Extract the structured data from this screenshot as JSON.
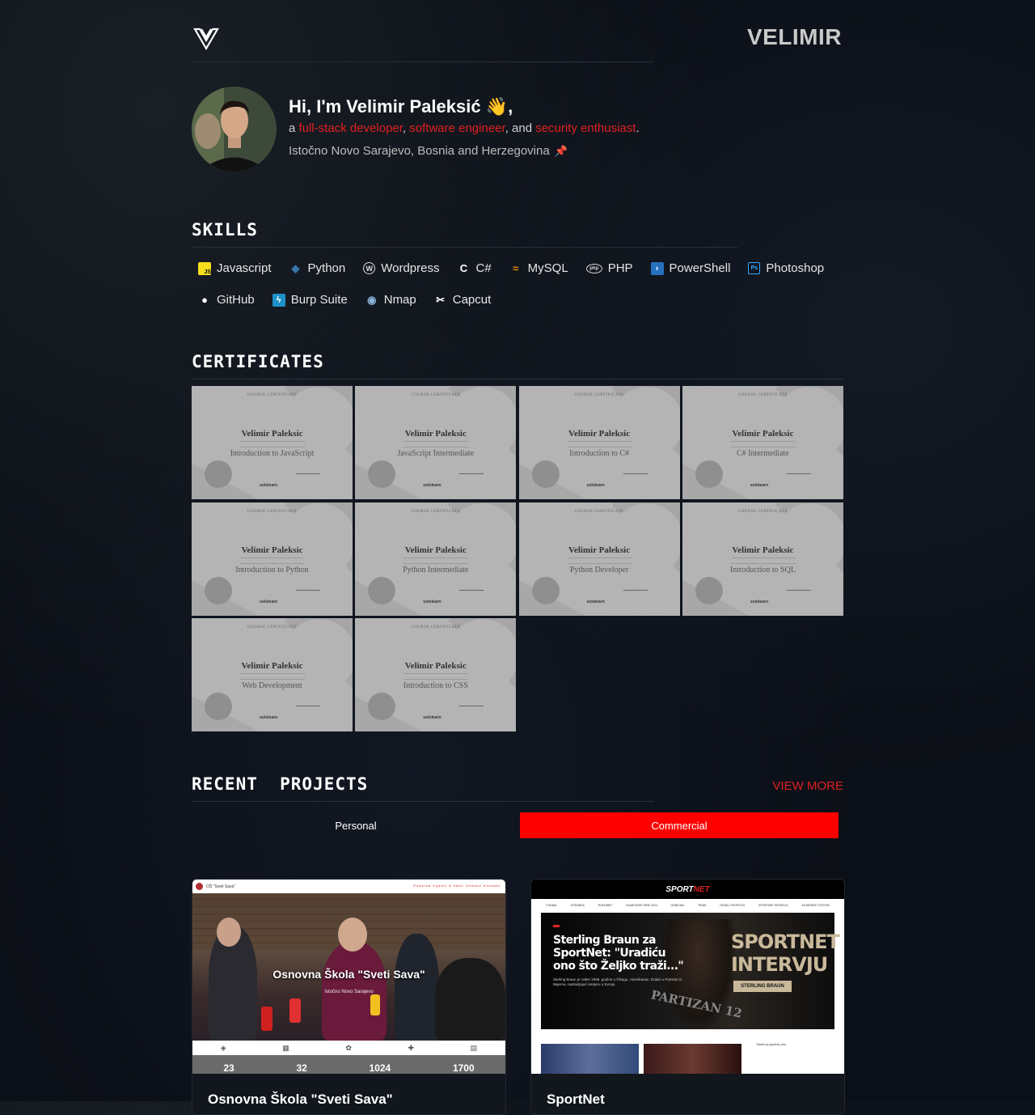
{
  "header": {
    "brand": "VELIMIR"
  },
  "intro": {
    "greeting": "Hi, I'm Velimir Paleksić 👋,",
    "tagline_prefix": "a ",
    "role1": "full-stack developer",
    "sep1": ", ",
    "role2": "software engineer",
    "sep2": ", and ",
    "role3": "security enthusiast",
    "tagline_suffix": ".",
    "location": "Istočno Novo Sarajevo, Bosnia and Herzegovina"
  },
  "skills": {
    "title": "SKILLS",
    "items": [
      {
        "label": "Javascript",
        "icon": "javascript-icon",
        "color": "#f7df1e"
      },
      {
        "label": "Python",
        "icon": "python-icon",
        "color": "#3776ab"
      },
      {
        "label": "Wordpress",
        "icon": "wordpress-icon",
        "color": "#21759b"
      },
      {
        "label": "C#",
        "icon": "csharp-icon",
        "color": "#ffffff"
      },
      {
        "label": "MySQL",
        "icon": "mysql-icon",
        "color": "#e48e00"
      },
      {
        "label": "PHP",
        "icon": "php-icon",
        "color": "#ffffff"
      },
      {
        "label": "PowerShell",
        "icon": "powershell-icon",
        "color": "#2671be"
      },
      {
        "label": "Photoshop",
        "icon": "photoshop-icon",
        "color": "#31a8ff"
      },
      {
        "label": "GitHub",
        "icon": "github-icon",
        "color": "#ffffff"
      },
      {
        "label": "Burp Suite",
        "icon": "burp-suite-icon",
        "color": "#1e90c8"
      },
      {
        "label": "Nmap",
        "icon": "nmap-icon",
        "color": "#8ab4d8"
      },
      {
        "label": "Capcut",
        "icon": "capcut-icon",
        "color": "#ffffff"
      }
    ]
  },
  "certificates": {
    "title": "CERTIFICATES",
    "items": [
      {
        "header": "COURSE CERTIFICATE",
        "name": "Velimir Paleksic",
        "course": "Introduction to JavaScript",
        "issuer": "sololearn"
      },
      {
        "header": "COURSE CERTIFICATE",
        "name": "Velimir Paleksic",
        "course": "JavaScript Intermediate",
        "issuer": "sololearn"
      },
      {
        "header": "COURSE CERTIFICATE",
        "name": "Velimir Paleksic",
        "course": "Introduction to C#",
        "issuer": "sololearn"
      },
      {
        "header": "COURSE CERTIFICATE",
        "name": "Velimir Paleksic",
        "course": "C# Intermediate",
        "issuer": "sololearn"
      },
      {
        "header": "COURSE CERTIFICATE",
        "name": "Velimir Paleksic",
        "course": "Introduction to Python",
        "issuer": "sololearn"
      },
      {
        "header": "COURSE CERTIFICATE",
        "name": "Velimir Paleksic",
        "course": "Python Intermediate",
        "issuer": "sololearn"
      },
      {
        "header": "COURSE CERTIFICATE",
        "name": "Velimir Paleksic",
        "course": "Python Developer",
        "issuer": "sololearn"
      },
      {
        "header": "COURSE CERTIFICATE",
        "name": "Velimir Paleksic",
        "course": "Introduction to SQL",
        "issuer": "sololearn"
      },
      {
        "header": "COURSE CERTIFICATE",
        "name": "Velimir Paleksic",
        "course": "Web Development",
        "issuer": "sololearn"
      },
      {
        "header": "COURSE CERTIFICATE",
        "name": "Velimir Paleksic",
        "course": "Introduction to CSS",
        "issuer": "sololearn"
      }
    ]
  },
  "projects": {
    "title": "RECENT  PROJECTS",
    "view_more": "VIEW MORE",
    "tabs": {
      "personal": "Personal",
      "commercial": "Commercial",
      "active": "Commercial"
    },
    "accent": "#ff0000",
    "cards": [
      {
        "name": "Osnovna Škola \"Sveti Sava\"",
        "shot": {
          "site_label": "OŠ \"Sveti Sava\"",
          "nav": "Početna  Vijesti  O školi  Učenici  Kontakt",
          "hero_title": "Osnovna Škola \"Sveti Sava\"",
          "hero_sub": "Istočno Novo Sarajevo",
          "icons": [
            "◈",
            "▦",
            "✿",
            "✚",
            "▤"
          ],
          "stats": [
            "23",
            "32",
            "1024",
            "1700"
          ]
        }
      },
      {
        "name": "SportNet",
        "shot": {
          "logo_a": "SPORT",
          "logo_b": "NET",
          "nav": [
            "FUDBAL",
            "KOŠARKA",
            "RUKOMET",
            "OLIMPIJSKE IGRE 2024",
            "ODBOJKA",
            "TENIS",
            "OSTALI SPORTOVI",
            "SPORTNET INTERVJU",
            "KATARSKE TOSTOM"
          ],
          "headline": "Sterling Braun za SportNet: \"Uradiću ono što Željko traži...\"",
          "excerpt": "Sterling Braun je rođen 1996. godine u Čikagu, Amerikanac. Dolazi u Partizan iz Bajerna, nastavljajući karijeru u Evropi.",
          "tag": "SPORTNET INTERVJU",
          "badge": "STERLING BRAUN",
          "jersey": "PARTIZAN 12",
          "side_note": "Tweets by sportnet_info"
        }
      }
    ]
  }
}
